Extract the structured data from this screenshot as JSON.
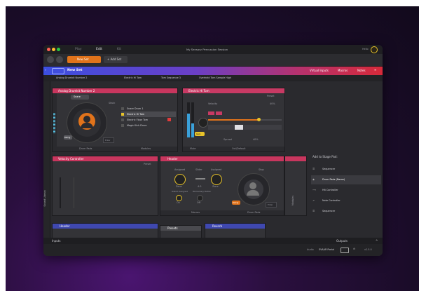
{
  "window": {
    "title": "My Sensory Percussion Session",
    "user": "Hello"
  },
  "tabs": [
    {
      "label": "Play"
    },
    {
      "label": "Edit"
    },
    {
      "label": "Kit"
    }
  ],
  "toolbar": {
    "set_name": "New Set",
    "add_set": "+ Add Set"
  },
  "set_bar": {
    "name": "New Set",
    "virtual_inputs": "Virtual Inputs",
    "macros": "Macros",
    "notes": "Notes"
  },
  "breadcrumbs": {
    "drum": "Analog Drumkit Number 2",
    "kit": "Electric Hi Tom",
    "sequence": "Tom Sequence 3",
    "sample": "Overheld Tom Sample High"
  },
  "panel_drum": {
    "title": "Analog Drumkit Number 2",
    "chip_label": "Snare",
    "stack_label": "Stack",
    "drum_pads_label": "Drum Pads",
    "modules_label": "Modules",
    "edit_label": "Retrig",
    "entry_label": "Enter",
    "modules": [
      {
        "label": "Snare Drum 1"
      },
      {
        "label": "Electric Hi Tom"
      },
      {
        "label": "Electric Floor Tom"
      },
      {
        "label": "Magic Kick Drum"
      }
    ]
  },
  "panel_tom": {
    "title": "Electric Hi Tom",
    "velocity_label": "Velocity",
    "velocity_value": "40%",
    "spread_label": "Spread",
    "spread_value": "40%",
    "preset_label": "Preset",
    "oct_label": "Oct/Default",
    "knob_label": "Gain",
    "mute_label": "Mute",
    "midi_label": "MIDI Ch"
  },
  "panel_velocity": {
    "title": "Velocity Controller",
    "preset": "Preset"
  },
  "panel_header": {
    "title": "Header",
    "assigned_left": "Assigned",
    "slider_label": "Slider",
    "assigned_right": "Assigned",
    "value_left": "Zone",
    "value_mid": "4.0",
    "value_right": "Zone",
    "label_left": "Distort Assigned",
    "label_mid": "Momentary Button",
    "macros_label": "Macros",
    "drum_pads_label": "Drum Pads",
    "stop_label": "Stop",
    "on_label": "On",
    "off_label": "Off",
    "retrig_label": "Retrig",
    "enter_label": "Enter",
    "modules_label": "Modules"
  },
  "add_pad": {
    "title": "Add to Stage Pad:",
    "items": [
      {
        "label": "Sequencer"
      },
      {
        "label": "Drum Pads (Name)"
      },
      {
        "label": "Hit Controller"
      },
      {
        "label": "Note Controller"
      },
      {
        "label": "Sequencer"
      }
    ]
  },
  "lower_panels": {
    "header_title": "Header",
    "presets_title": "Presets",
    "reverb_title": "Reverb"
  },
  "sidebar": {
    "label": "Sound Library"
  },
  "bottom": {
    "inputs_label": "Inputs",
    "outputs_label": "Outputs"
  },
  "status": {
    "device_label": "Audio",
    "device": "EVAAR Portal",
    "version": "v2.5.0"
  },
  "colors": {
    "accent_orange": "#e1731b",
    "set_bar_start": "#3c4fe0",
    "set_bar_end": "#d62a3a",
    "module_pink": "#c8365e",
    "tom_pink": "#c83a64",
    "header_blue": "#3f48b0",
    "yellow": "#e8c32a"
  }
}
